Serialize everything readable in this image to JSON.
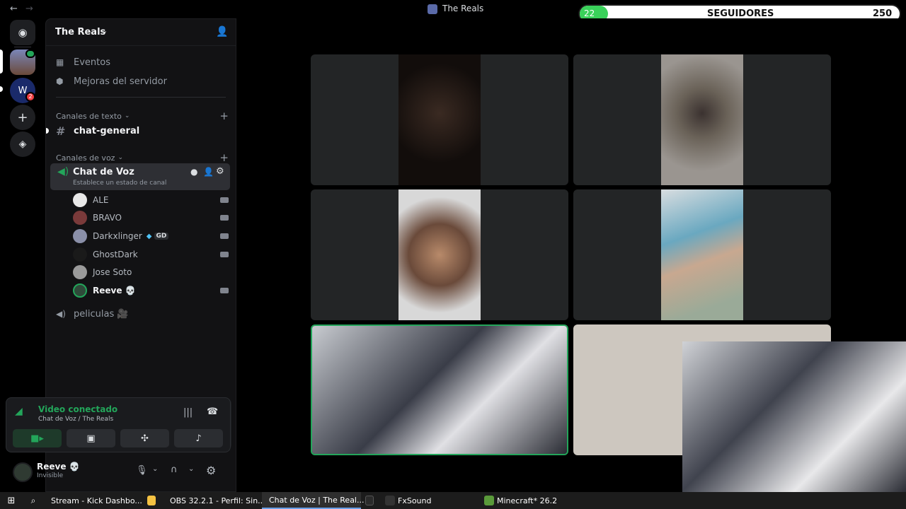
{
  "titlebar": {
    "title": "The Reals",
    "follow_count": "22",
    "follow_label": "SEGUIDORES",
    "follow_goal": "250"
  },
  "server": {
    "name": "The Reals"
  },
  "nav": {
    "events": "Eventos",
    "boosts": "Mejoras del servidor"
  },
  "text_channels": {
    "header": "Canales de texto",
    "items": [
      "chat-general"
    ]
  },
  "voice_channels": {
    "header": "Canales de voz",
    "active": {
      "name": "Chat de Voz",
      "status": "Establece un estado de canal"
    },
    "members": [
      "ALE",
      "BRAVO",
      "Darkxlinger",
      "GhostDark",
      "Jose Soto",
      "Reeve 💀"
    ],
    "darkx_badge": "GD",
    "other": "peliculas 🎥"
  },
  "voice_panel": {
    "status": "Video conectado",
    "location": "Chat de Voz / The Reals"
  },
  "user": {
    "name": "Reeve 💀",
    "status": "Invisible"
  },
  "taskbar": {
    "items": [
      "Stream - Kick Dashbo...",
      "OBS 32.2.1 - Perfil: Sin...",
      "Chat de Voz | The Real...",
      "",
      "FxSound",
      "Minecraft* 26.2"
    ]
  },
  "colors": {
    "green": "#23a55a",
    "accent": "#5865f2",
    "red": "#f23f43"
  }
}
